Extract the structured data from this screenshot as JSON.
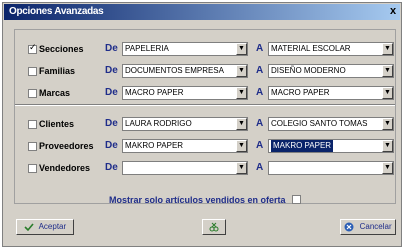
{
  "window": {
    "title": "Opciones Avanzadas",
    "close": "x"
  },
  "rows": [
    {
      "label": "Secciones",
      "checked": true,
      "de": "De",
      "from": "PAPELERIA",
      "a": "A",
      "to": "MATERIAL ESCOLAR"
    },
    {
      "label": "Familias",
      "checked": false,
      "de": "De",
      "from": "DOCUMENTOS EMPRESA",
      "a": "A",
      "to": "DISEÑO MODERNO"
    },
    {
      "label": "Marcas",
      "checked": false,
      "de": "De",
      "from": "MACRO PAPER",
      "a": "A",
      "to": "MACRO PAPER"
    },
    {
      "label": "Clientes",
      "checked": false,
      "de": "De",
      "from": "LAURA RODRIGO",
      "a": "A",
      "to": "COLEGIO SANTO TOMAS"
    },
    {
      "label": "Proveedores",
      "checked": false,
      "de": "De",
      "from": "MAKRO PAPER",
      "a": "A",
      "to": "MAKRO PAPER"
    },
    {
      "label": "Vendedores",
      "checked": false,
      "de": "De",
      "from": "",
      "a": "A",
      "to": ""
    }
  ],
  "footer": {
    "only_offer_label": "Mostrar solo artículos vendidos en oferta",
    "accept_label": "Aceptar",
    "cancel_label": "Cancelar"
  },
  "icons": {
    "accept": "checkmark-icon",
    "cancel": "cancel-icon",
    "center": "scissors-icon"
  },
  "colors": {
    "title_bar": "#0a246a",
    "accent_text": "#1f2d8a",
    "selection": "#0a246a"
  }
}
